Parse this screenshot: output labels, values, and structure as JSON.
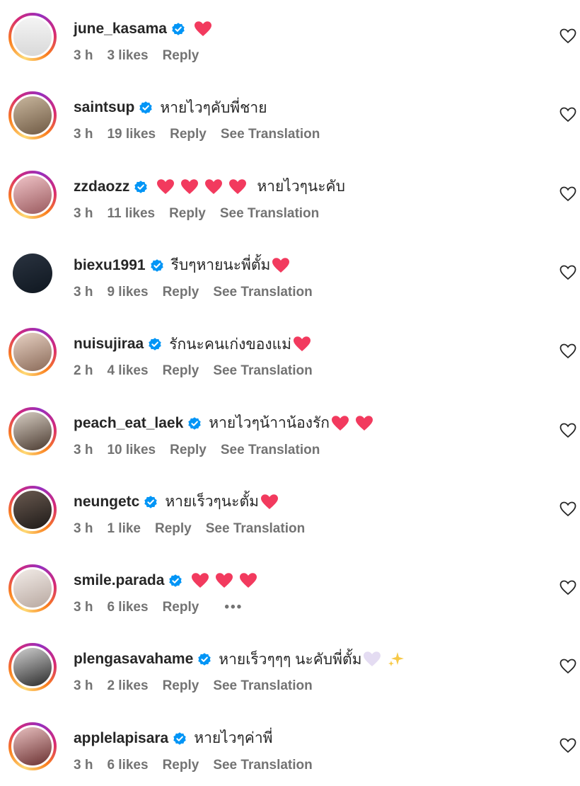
{
  "colors": {
    "heart_red": "#f23a5e",
    "verified_blue": "#0095f6",
    "meta_gray": "#737373",
    "text": "#262626",
    "heart_pale": "#e4dcf2",
    "sparkle": "#f7c948"
  },
  "labels": {
    "reply": "Reply",
    "see_translation": "See Translation",
    "more": "•••"
  },
  "comments": [
    {
      "username": "june_kasama",
      "text": "",
      "reactions": [
        "heart-red"
      ],
      "time": "3 h",
      "likes": "3 likes",
      "see_translation": false,
      "more_options": false,
      "avatar_ring": true
    },
    {
      "username": "saintsup",
      "text": "หายไวๆคับพี่ชาย",
      "reactions": [],
      "time": "3 h",
      "likes": "19 likes",
      "see_translation": true,
      "more_options": false,
      "avatar_ring": true
    },
    {
      "username": "zzdaozz",
      "text": "หายไวๆนะคับ",
      "reactions_before_text": [
        "heart-red",
        "heart-red",
        "heart-red",
        "heart-red"
      ],
      "reactions": [],
      "time": "3 h",
      "likes": "11 likes",
      "see_translation": true,
      "more_options": false,
      "avatar_ring": true
    },
    {
      "username": "biexu1991",
      "text": "รีบๆหายนะพี่ตั้ม",
      "reactions": [
        "heart-red"
      ],
      "time": "3 h",
      "likes": "9 likes",
      "see_translation": true,
      "more_options": false,
      "avatar_ring": false
    },
    {
      "username": "nuisujiraa",
      "text": "รักนะคนเก่งของแม่",
      "reactions": [
        "heart-red"
      ],
      "time": "2 h",
      "likes": "4 likes",
      "see_translation": true,
      "more_options": false,
      "avatar_ring": true
    },
    {
      "username": "peach_eat_laek",
      "text": "หายไวๆน้าาน้องรัก",
      "reactions": [
        "heart-red",
        "heart-red"
      ],
      "time": "3 h",
      "likes": "10 likes",
      "see_translation": true,
      "more_options": false,
      "avatar_ring": true
    },
    {
      "username": "neungetc",
      "text": "หายเร็วๆนะตั้ม",
      "reactions": [
        "heart-red"
      ],
      "time": "3 h",
      "likes": "1 like",
      "see_translation": true,
      "more_options": false,
      "avatar_ring": true
    },
    {
      "username": "smile.parada",
      "text": "",
      "reactions": [
        "heart-red",
        "heart-red",
        "heart-red"
      ],
      "time": "3 h",
      "likes": "6 likes",
      "see_translation": false,
      "more_options": true,
      "avatar_ring": true
    },
    {
      "username": "plengasavahame",
      "text": "หายเร็วๆๆๆ นะคับพี่ตั้ม",
      "reactions": [
        "heart-pale",
        "sparkles"
      ],
      "time": "3 h",
      "likes": "2 likes",
      "see_translation": true,
      "more_options": false,
      "avatar_ring": true
    },
    {
      "username": "applelapisara",
      "text": "หายไวๆค่าพี่",
      "reactions": [],
      "time": "3 h",
      "likes": "6 likes",
      "see_translation": true,
      "more_options": false,
      "avatar_ring": true
    }
  ]
}
